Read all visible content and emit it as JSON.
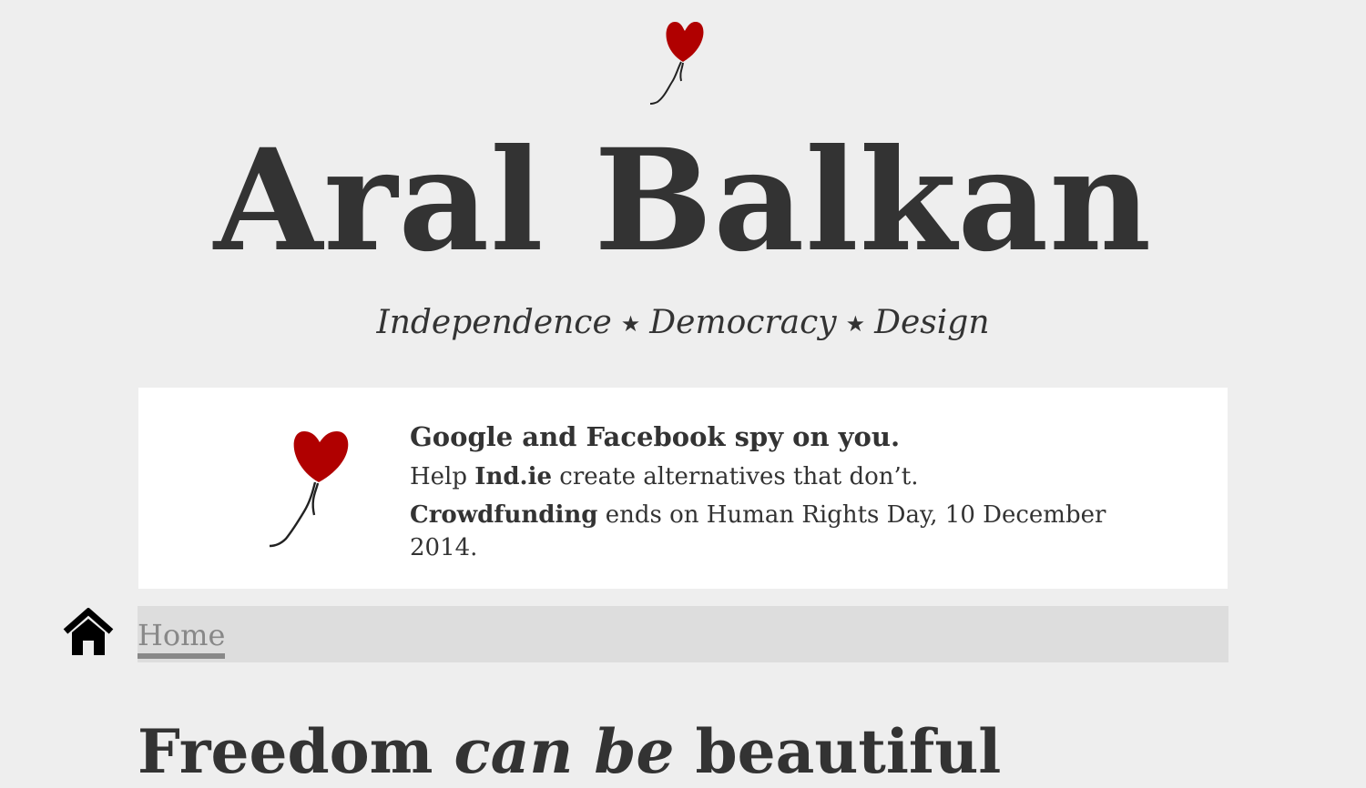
{
  "site": {
    "title": "Aral Balkan",
    "tagline": {
      "parts": [
        "Independence",
        "Democracy",
        "Design"
      ],
      "separator": "★"
    }
  },
  "banner": {
    "headline": "Google and Facebook spy on you.",
    "line1": {
      "prefix": "Help ",
      "strong": "Ind.ie",
      "suffix": " create alternatives that don’t."
    },
    "line2": {
      "strong": "Crowdfunding",
      "suffix": " ends on Human Rights Day, 10 December 2014."
    }
  },
  "nav": {
    "home_label": "Home"
  },
  "post": {
    "title_start": "Freedom ",
    "title_emphasis": "can be",
    "title_end": " beautiful"
  },
  "icons": {
    "header_balloon": "heart-balloon-icon",
    "banner_balloon": "heart-balloon-icon",
    "home": "home-icon"
  },
  "colors": {
    "background": "#eeeeee",
    "text": "#333333",
    "heart": "#b00000",
    "banner_background": "#ffffff",
    "nav_background": "#dddddd",
    "nav_link": "#888888"
  }
}
